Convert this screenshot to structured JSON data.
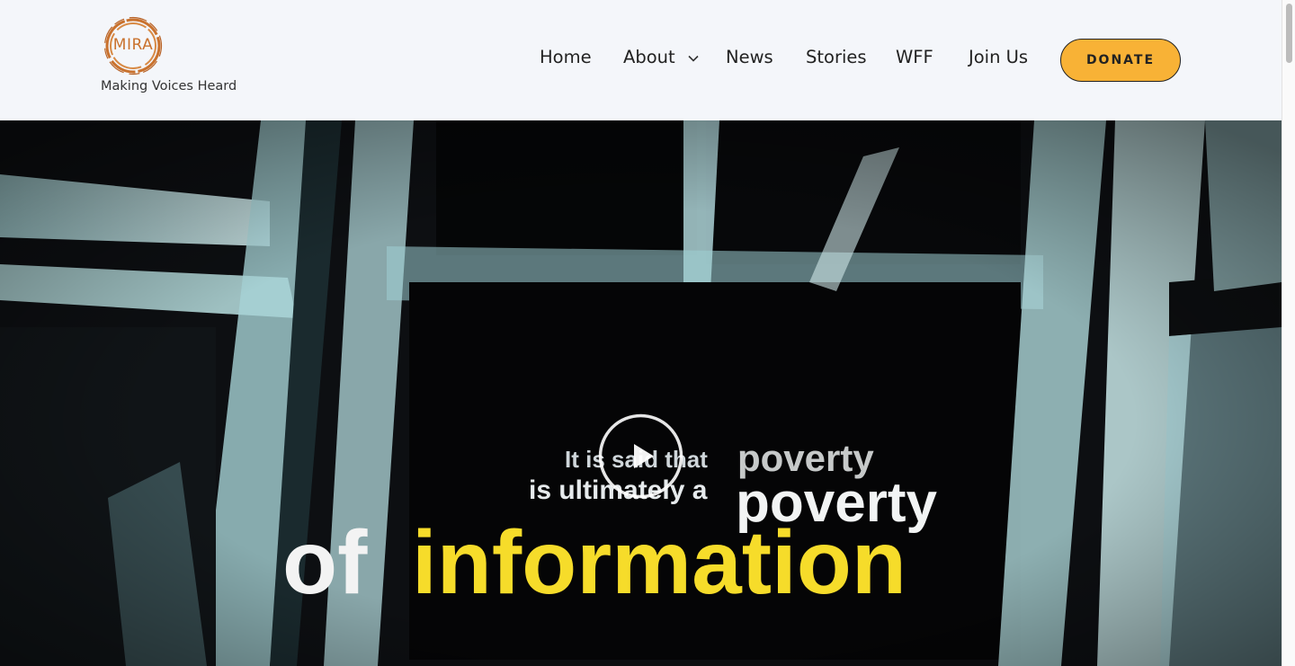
{
  "brand": {
    "logo_text": "MIRA",
    "tagline": "Making Voices Heard"
  },
  "nav": {
    "items": [
      {
        "label": "Home"
      },
      {
        "label": "About",
        "has_dropdown": true
      },
      {
        "label": "News"
      },
      {
        "label": "Stories"
      },
      {
        "label": "WFF"
      },
      {
        "label": "Join Us"
      }
    ],
    "donate_label": "DONATE"
  },
  "hero": {
    "caption_line1_part1": "It is said that",
    "caption_line1_part2": "poverty",
    "caption_line2_part1": "is ultimately a",
    "caption_line2_part2": "poverty",
    "caption_line3_part1": "of",
    "caption_line3_part2": "information",
    "play_icon": "play-circle-icon"
  },
  "colors": {
    "brand_orange": "#c9722e",
    "donate_yellow": "#f8b236",
    "caption_yellow": "#f6dc2a"
  }
}
